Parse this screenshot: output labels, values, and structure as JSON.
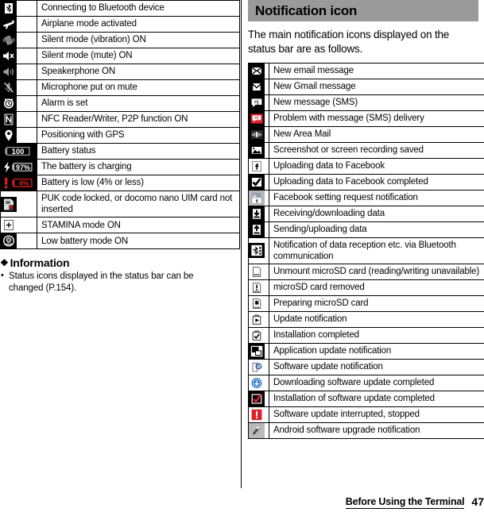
{
  "left_table": {
    "rows": [
      {
        "icon": "bluetooth-connecting-icon",
        "label": "Connecting to Bluetooth device"
      },
      {
        "icon": "airplane-mode-icon",
        "label": "Airplane mode activated"
      },
      {
        "icon": "vibration-mode-icon",
        "label": "Silent mode (vibration) ON"
      },
      {
        "icon": "mute-mode-icon",
        "label": "Silent mode (mute) ON"
      },
      {
        "icon": "speakerphone-icon",
        "label": "Speakerphone ON"
      },
      {
        "icon": "microphone-mute-icon",
        "label": "Microphone put on mute"
      },
      {
        "icon": "alarm-clock-icon",
        "label": "Alarm is set"
      },
      {
        "icon": "nfc-icon",
        "label": "NFC Reader/Writer, P2P function ON"
      },
      {
        "icon": "gps-pin-icon",
        "label": "Positioning with GPS"
      },
      {
        "icon": "battery-status-icon",
        "label": "Battery status",
        "icon_text": "100"
      },
      {
        "icon": "battery-charging-icon",
        "label": "The battery is charging",
        "icon_text": "97%"
      },
      {
        "icon": "battery-low-icon",
        "label": "Battery is low (4% or less)",
        "icon_text": "4%"
      },
      {
        "icon": "uim-card-error-icon",
        "label": "PUK code locked, or docomo nano UIM card not inserted"
      },
      {
        "icon": "stamina-mode-icon",
        "label": "STAMINA mode ON",
        "icon_text": "+"
      },
      {
        "icon": "low-battery-mode-icon",
        "label": "Low battery mode ON"
      }
    ]
  },
  "information": {
    "heading": "Information",
    "diamond": "❖",
    "items": [
      "Status icons displayed in the status bar can be changed (P.154)."
    ]
  },
  "section": {
    "title": "Notification icon",
    "intro": "The main notification icons displayed on the status bar are as follows."
  },
  "right_table": {
    "rows": [
      {
        "icon": "new-email-icon",
        "label": "New email message"
      },
      {
        "icon": "new-gmail-icon",
        "label": "New Gmail message"
      },
      {
        "icon": "new-sms-icon",
        "label": "New message (SMS)"
      },
      {
        "icon": "sms-delivery-problem-icon",
        "label": "Problem with message (SMS) delivery"
      },
      {
        "icon": "area-mail-icon",
        "label": "New Area Mail"
      },
      {
        "icon": "screenshot-saved-icon",
        "label": "Screenshot or screen recording saved"
      },
      {
        "icon": "facebook-upload-icon",
        "label": "Uploading data to Facebook"
      },
      {
        "icon": "facebook-upload-complete-icon",
        "label": "Uploading data to Facebook completed"
      },
      {
        "icon": "facebook-setting-request-icon",
        "label": "Facebook setting request notification"
      },
      {
        "icon": "download-data-icon",
        "label": "Receiving/downloading data"
      },
      {
        "icon": "upload-data-icon",
        "label": "Sending/uploading data"
      },
      {
        "icon": "bluetooth-data-icon",
        "label": "Notification of data reception etc. via Bluetooth communication"
      },
      {
        "icon": "microsd-unmount-icon",
        "label": "Unmount microSD card (reading/writing unavailable)"
      },
      {
        "icon": "microsd-removed-icon",
        "label": "microSD card removed"
      },
      {
        "icon": "microsd-preparing-icon",
        "label": "Preparing microSD card"
      },
      {
        "icon": "update-notification-icon",
        "label": "Update notification"
      },
      {
        "icon": "installation-complete-icon",
        "label": "Installation completed"
      },
      {
        "icon": "app-update-icon",
        "label": "Application update notification"
      },
      {
        "icon": "software-update-icon",
        "label": "Software update notification"
      },
      {
        "icon": "software-download-complete-icon",
        "label": "Downloading software update completed"
      },
      {
        "icon": "software-install-complete-icon",
        "label": "Installation of software update completed"
      },
      {
        "icon": "software-update-interrupted-icon",
        "label": "Software update interrupted, stopped"
      },
      {
        "icon": "android-upgrade-icon",
        "label": "Android software upgrade notification"
      }
    ]
  },
  "footer": {
    "title": "Before Using the Terminal",
    "page": "47"
  },
  "colors": {
    "heading_band": "#9a9a9a",
    "icon_black": "#000000",
    "alert_red": "#d81e20",
    "download_blue": "#1b6fc4"
  }
}
